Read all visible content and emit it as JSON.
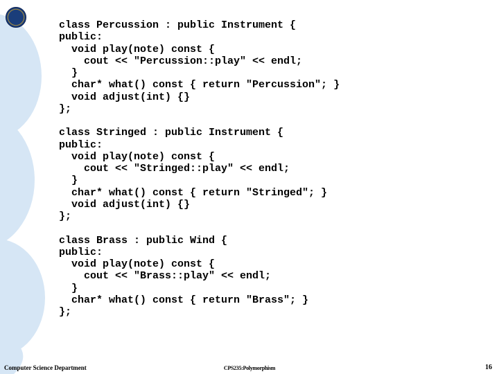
{
  "code": "class Percussion : public Instrument {\npublic:\n  void play(note) const {\n    cout << \"Percussion::play\" << endl;\n  }\n  char* what() const { return \"Percussion\"; }\n  void adjust(int) {}\n};\n\nclass Stringed : public Instrument {\npublic:\n  void play(note) const {\n    cout << \"Stringed::play\" << endl;\n  }\n  char* what() const { return \"Stringed\"; }\n  void adjust(int) {}\n};\n\nclass Brass : public Wind {\npublic:\n  void play(note) const {\n    cout << \"Brass::play\" << endl;\n  }\n  char* what() const { return \"Brass\"; }\n};",
  "footer": {
    "left": "Computer Science Department",
    "center": "CPS235:Polymorphism",
    "right": "16"
  },
  "colors": {
    "accent": "#d6e6f5"
  }
}
